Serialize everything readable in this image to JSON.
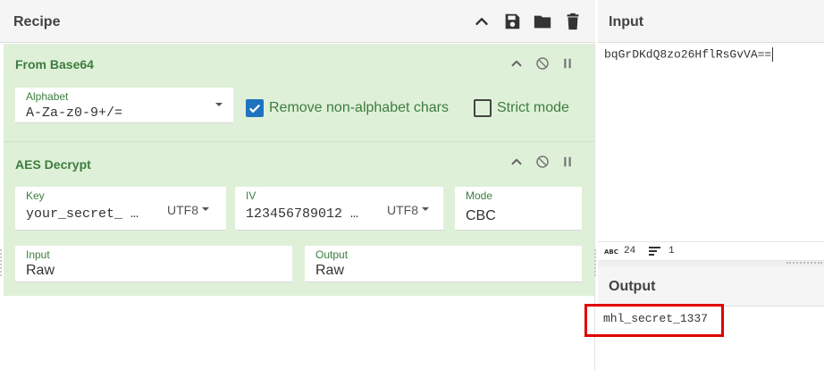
{
  "recipe": {
    "title": "Recipe",
    "icons": [
      "chevron-up-icon",
      "save-icon",
      "folder-icon",
      "trash-icon"
    ]
  },
  "ops": [
    {
      "name": "From Base64",
      "alphabet_label": "Alphabet",
      "alphabet_value": "A-Za-z0-9+/=",
      "remove_nonalpha_label": "Remove non-alphabet chars",
      "remove_nonalpha_checked": true,
      "strict_mode_label": "Strict mode",
      "strict_mode_checked": false
    },
    {
      "name": "AES Decrypt",
      "key_label": "Key",
      "key_value": "your_secret_ …",
      "key_encoding": "UTF8",
      "iv_label": "IV",
      "iv_value": "123456789012 …",
      "iv_encoding": "UTF8",
      "mode_label": "Mode",
      "mode_value": "CBC",
      "input_label": "Input",
      "input_value": "Raw",
      "output_label": "Output",
      "output_value": "Raw"
    }
  ],
  "input": {
    "title": "Input",
    "value": "bqGrDKdQ8zo26HflRsGvVA==",
    "stats": {
      "chars_icon": "abc-icon",
      "chars": "24",
      "lines_icon": "lines-icon",
      "lines": "1"
    }
  },
  "output": {
    "title": "Output",
    "value": "mhl_secret_1337"
  },
  "colors": {
    "op_background": "#dff0d8",
    "op_text": "#3c7d3e",
    "checkbox_on": "#1e73be",
    "highlight": "#e00000"
  }
}
